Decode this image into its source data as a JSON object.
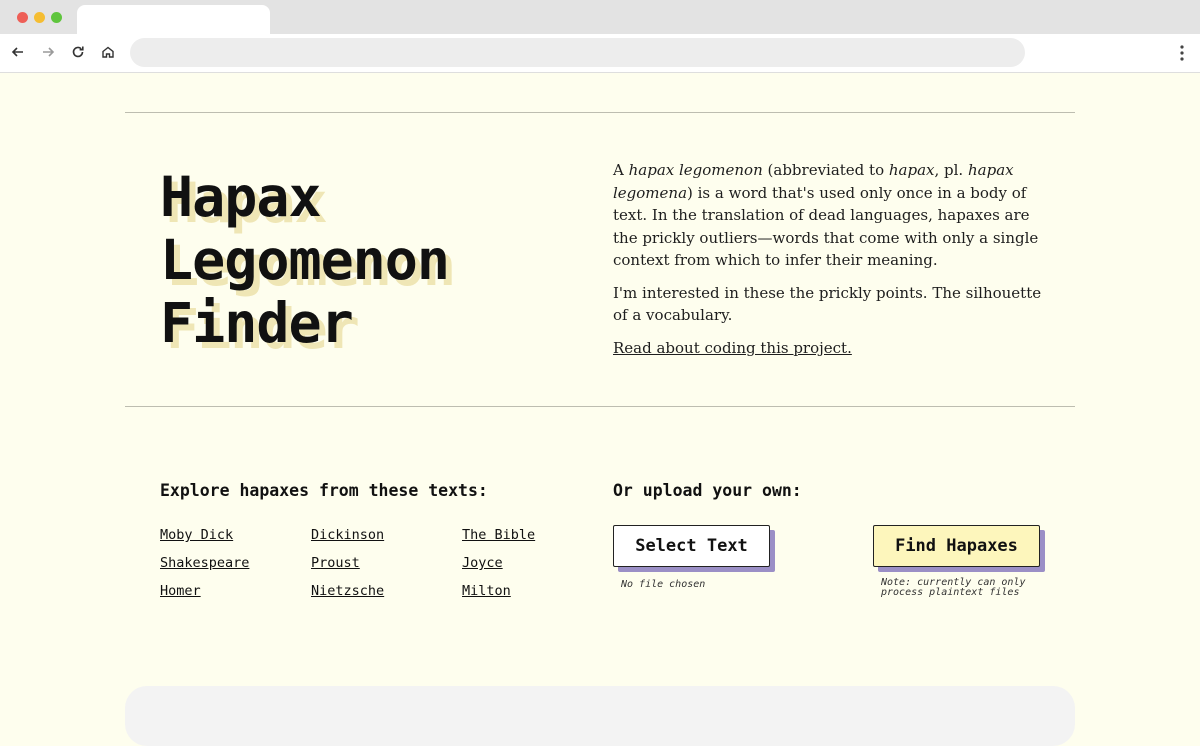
{
  "browser": {
    "nav": {
      "back_icon": "arrow-left-icon",
      "forward_icon": "arrow-right-icon",
      "reload_icon": "reload-icon",
      "home_icon": "home-icon",
      "menu_icon": "kebab-menu-icon"
    },
    "address_value": ""
  },
  "hero": {
    "title_lines": [
      "Hapax",
      "Legomenon",
      "Finder"
    ],
    "intro": {
      "p1_a": "A ",
      "p1_term": "hapax legomenon",
      "p1_b": " (abbreviated to ",
      "p1_short": "hapax",
      "p1_c": ", pl. ",
      "p1_plural": "hapax legomena",
      "p1_d": ") is a word that's used only once in a body of text. In the translation of dead languages, hapaxes are the prickly outliers—words that come with only a single context from which to infer their meaning.",
      "p2": "I'm interested in these the prickly points. The silhouette of a vocabulary.",
      "link": "Read about coding this project."
    }
  },
  "explore": {
    "heading": "Explore hapaxes from these texts:",
    "texts": [
      "Moby Dick",
      "Dickinson",
      "The Bible",
      "Shakespeare",
      "Proust",
      "Joyce",
      "Homer",
      "Nietzsche",
      "Milton"
    ]
  },
  "upload": {
    "heading": "Or upload your own:",
    "select_label": "Select Text",
    "file_status": "No file chosen",
    "find_label": "Find Hapaxes",
    "note": "Note: currently can only process plaintext files"
  },
  "colors": {
    "page_bg": "#fefeee",
    "title_shadow": "#efe6b5",
    "button_shadow": "#9b8fc6",
    "find_bg": "#fdf6bc"
  }
}
